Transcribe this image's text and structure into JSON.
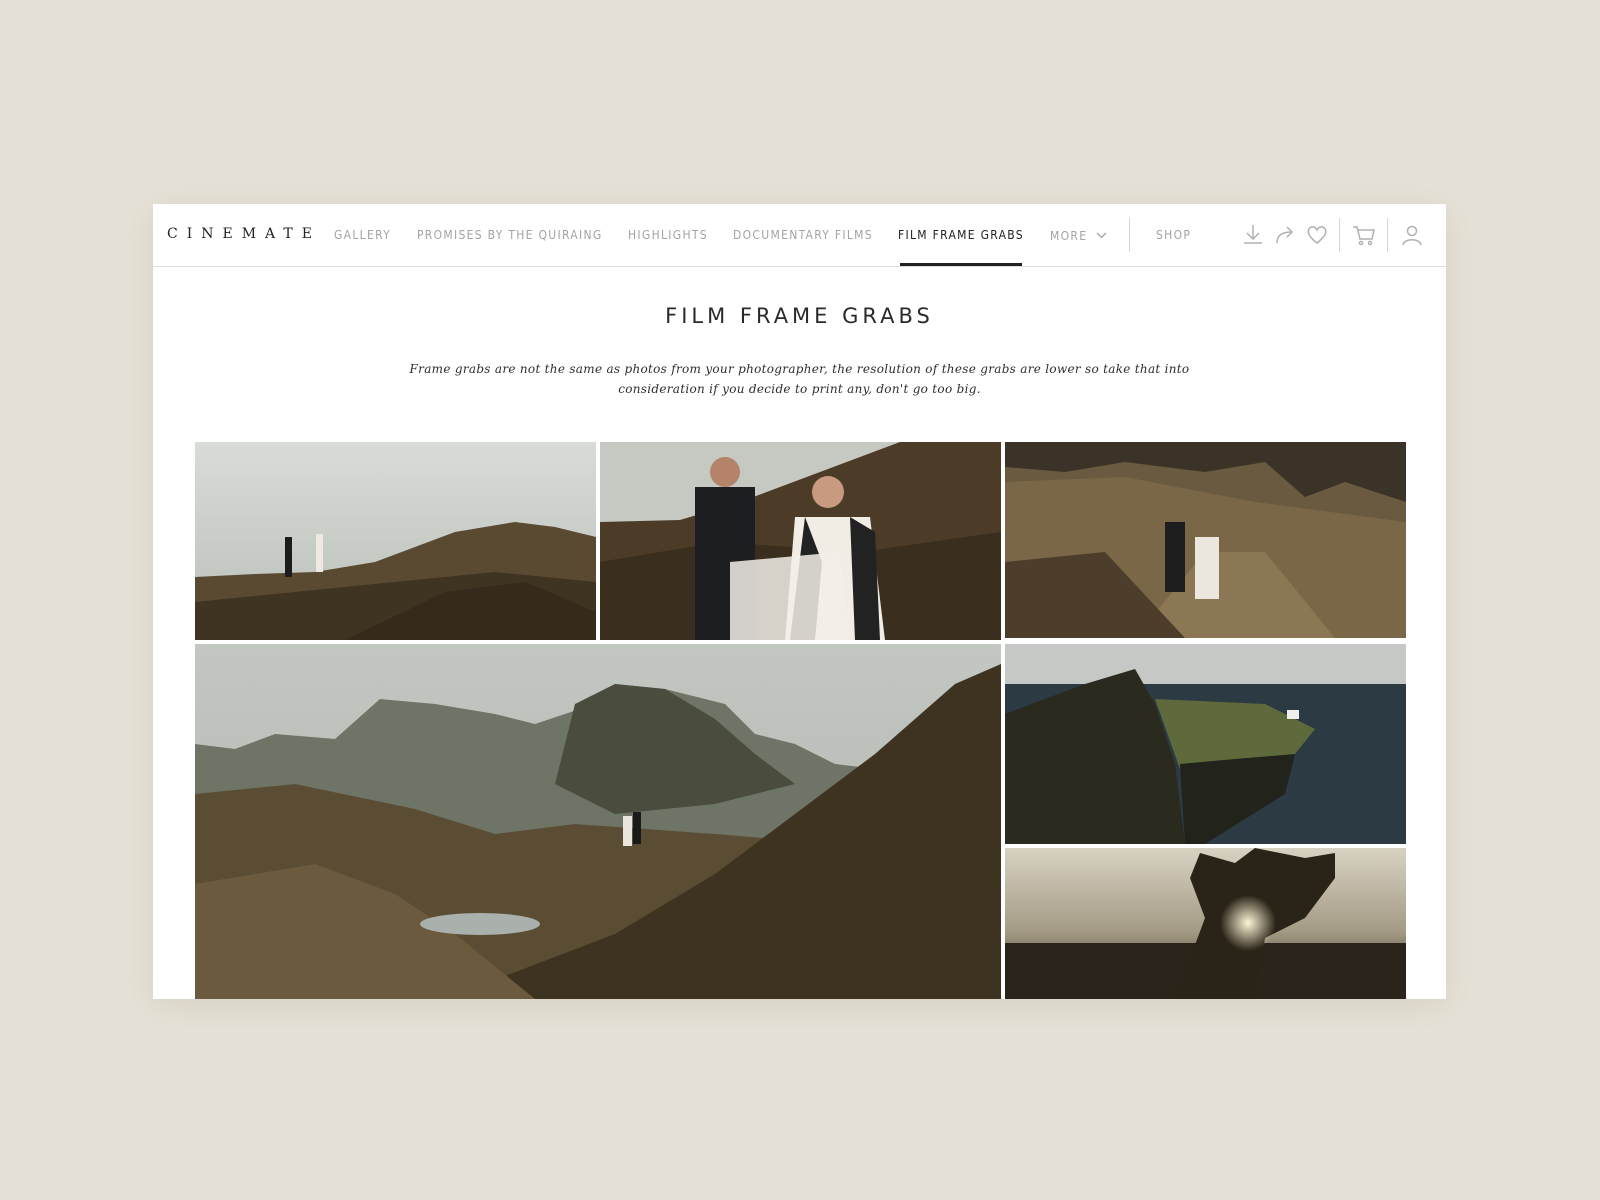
{
  "brand": "CINEMATE",
  "nav": {
    "items": [
      {
        "label": "GALLERY",
        "active": false
      },
      {
        "label": "PROMISES BY THE QUIRAING",
        "active": false
      },
      {
        "label": "HIGHLIGHTS",
        "active": false
      },
      {
        "label": "DOCUMENTARY FILMS",
        "active": false
      },
      {
        "label": "FILM FRAME GRABS",
        "active": true
      },
      {
        "label": "MORE",
        "active": false
      }
    ],
    "shop": "SHOP"
  },
  "toolbar_icons": [
    "download-icon",
    "share-icon",
    "heart-icon",
    "cart-icon",
    "user-icon"
  ],
  "page": {
    "title": "FILM FRAME GRABS",
    "description": "Frame grabs are not the same as photos from your photographer, the resolution of these grabs are lower so take that into consideration if you decide to print any, don't go too big."
  },
  "photos": [
    {
      "name": "photo-couple-on-hillside"
    },
    {
      "name": "photo-couple-walking-closeup"
    },
    {
      "name": "photo-couple-on-path"
    },
    {
      "name": "photo-quiraing-landscape"
    },
    {
      "name": "photo-coastal-lighthouse"
    },
    {
      "name": "photo-sun-through-heather"
    }
  ],
  "colors": {
    "background": "#e6e1d6",
    "nav_active": "#222222",
    "nav_inactive": "#a3a3a3"
  }
}
